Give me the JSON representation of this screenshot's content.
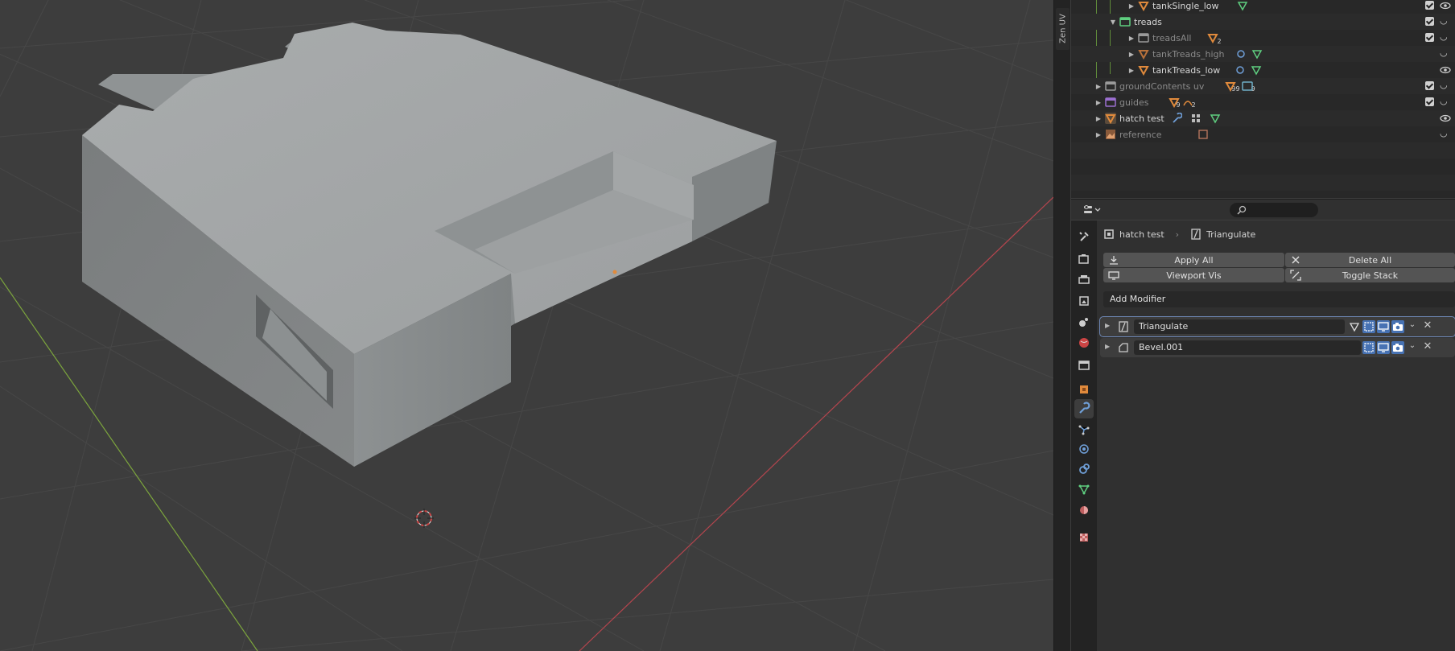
{
  "zen_uv": {
    "tab_label": "Zen UV"
  },
  "outliner": {
    "rows": [
      {
        "label": "tankSingle_low",
        "depth": 3,
        "icon": "mesh-triangle-icon",
        "dim": false
      },
      {
        "label": "treads",
        "depth": 2,
        "icon": "collection-icon",
        "dim": false
      },
      {
        "label": "treadsAll",
        "depth": 3,
        "icon": "collection-icon",
        "dim": true,
        "badge": "2"
      },
      {
        "label": "tankTreads_high",
        "depth": 3,
        "icon": "mesh-triangle-icon",
        "dim": true
      },
      {
        "label": "tankTreads_low",
        "depth": 3,
        "icon": "mesh-triangle-icon",
        "dim": false
      },
      {
        "label": "groundContents uv",
        "depth": 1,
        "icon": "collection-icon",
        "dim": true,
        "badge": "99",
        "badge2": "9"
      },
      {
        "label": "guides",
        "depth": 1,
        "icon": "collection-icon",
        "dim": true,
        "badge": "9",
        "badge2": "2"
      },
      {
        "label": "hatch test",
        "depth": 1,
        "icon": "mesh-triangle-icon",
        "dim": false
      },
      {
        "label": "reference",
        "depth": 1,
        "icon": "image-icon",
        "dim": true
      }
    ]
  },
  "properties": {
    "search_placeholder": "",
    "breadcrumb": {
      "object": "hatch test",
      "modifier": "Triangulate"
    },
    "buttons": {
      "apply_all": "Apply All",
      "delete_all": "Delete All",
      "viewport_vis": "Viewport Vis",
      "toggle_stack": "Toggle Stack"
    },
    "add_modifier": "Add Modifier",
    "modifiers": [
      {
        "name": "Triangulate",
        "selected": true
      },
      {
        "name": "Bevel.001",
        "selected": false
      }
    ]
  },
  "colors": {
    "accent": "#4772b3",
    "object_orange": "#e08a3c",
    "mesh_green": "#5fcf80",
    "x_axis": "#b5454e",
    "y_axis": "#7ca53d"
  }
}
